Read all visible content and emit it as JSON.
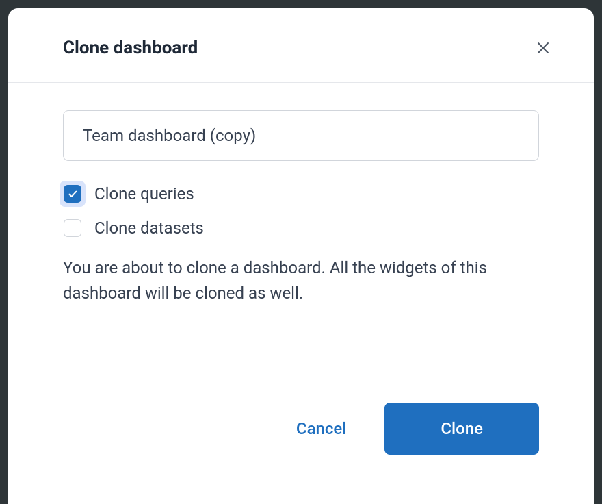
{
  "modal": {
    "title": "Clone dashboard",
    "name_value": "Team dashboard (copy)",
    "checkboxes": {
      "queries": {
        "label": "Clone queries",
        "checked": true
      },
      "datasets": {
        "label": "Clone datasets",
        "checked": false
      }
    },
    "description": "You are about to clone a dashboard. All the widgets of this dashboard will be cloned as well.",
    "buttons": {
      "cancel": "Cancel",
      "confirm": "Clone"
    }
  }
}
